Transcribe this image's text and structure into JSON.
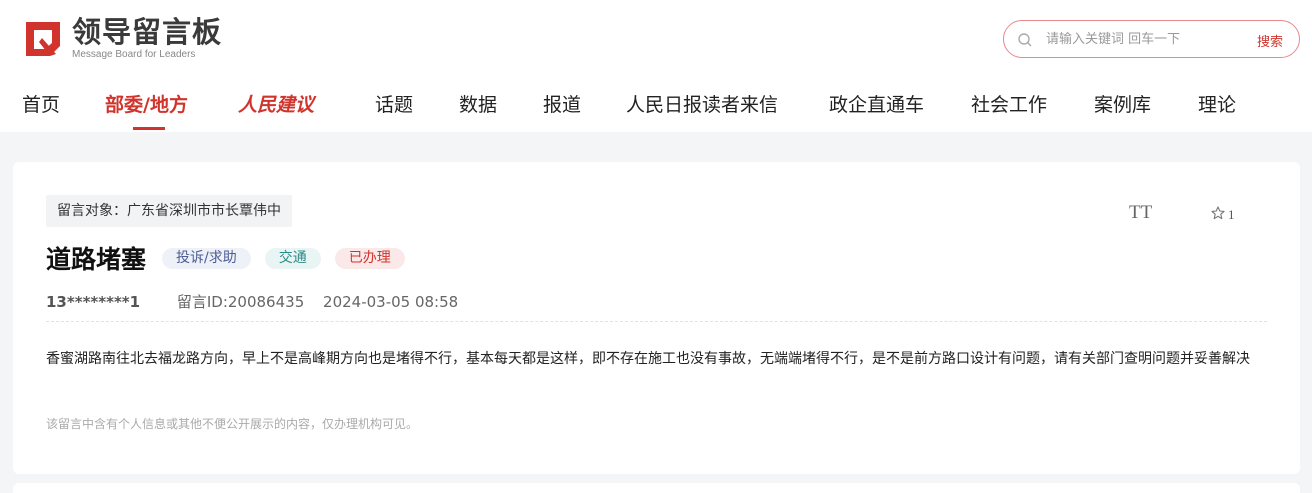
{
  "brand": {
    "name": "领导留言板",
    "subtitle": "Message Board for Leaders",
    "accent": "#d0342c"
  },
  "search": {
    "placeholder": "请输入关键词 回车一下",
    "button_label": "搜索"
  },
  "nav": {
    "items": [
      {
        "label": "首页"
      },
      {
        "label": "部委/地方",
        "active": true
      },
      {
        "label": "人民建议"
      },
      {
        "label": "话题"
      },
      {
        "label": "数据"
      },
      {
        "label": "报道"
      },
      {
        "label": "人民日报读者来信"
      },
      {
        "label": "政企直通车"
      },
      {
        "label": "社会工作"
      },
      {
        "label": "案例库"
      },
      {
        "label": "理论"
      }
    ]
  },
  "message": {
    "target": "留言对象：广东省深圳市市长覃伟中",
    "title": "道路堵塞",
    "tags": {
      "category": "投诉/求助",
      "field": "交通",
      "status": "已办理"
    },
    "author": "13********1",
    "message_id": "留言ID:20086435",
    "time": "2024-03-05 08:58",
    "content": "香蜜湖路南往北去福龙路方向，早上不是高峰期方向也是堵得不行，基本每天都是这样，即不存在施工也没有事故，无端端堵得不行，是不是前方路口设计有问题，请有关部门查明问题并妥善解决",
    "notice": "该留言中含有个人信息或其他不便公开展示的内容，仅办理机构可见。"
  },
  "tools": {
    "font_size_label": "TT",
    "favorite_count": "1"
  }
}
